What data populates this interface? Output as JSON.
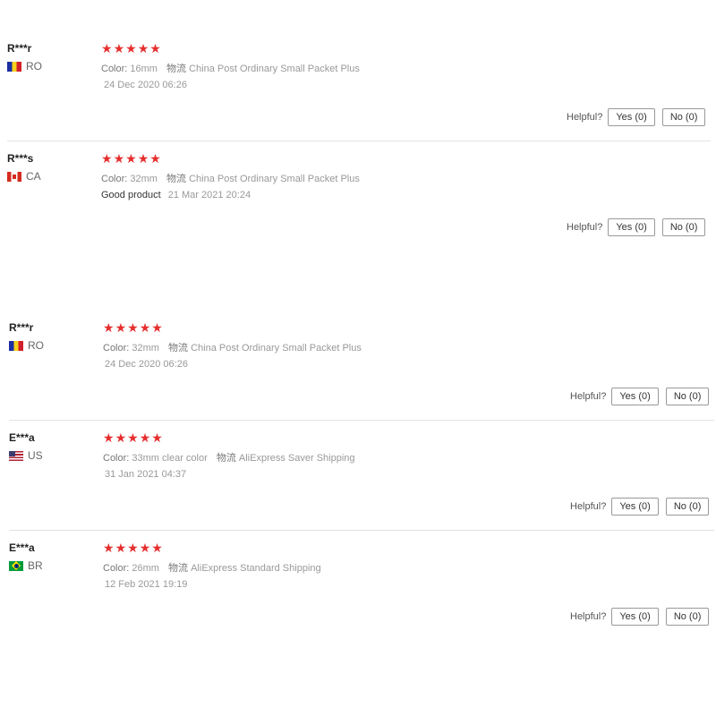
{
  "labels": {
    "color": "Color:",
    "logistics": "物流",
    "helpful": "Helpful?",
    "star_glyph": "★"
  },
  "reviews": [
    {
      "user": "R***r",
      "country": "RO",
      "flag_icon": "romania-flag-icon",
      "rating": 5,
      "color_value": "16mm",
      "shipping": "China Post Ordinary Small Packet Plus",
      "text": "",
      "date": "24 Dec 2020 06:26",
      "yes": "Yes (0)",
      "no": "No (0)"
    },
    {
      "user": "R***s",
      "country": "CA",
      "flag_icon": "canada-flag-icon",
      "rating": 5,
      "color_value": "32mm",
      "shipping": "China Post Ordinary Small Packet Plus",
      "text": "Good product",
      "date": "21 Mar 2021 20:24",
      "yes": "Yes (0)",
      "no": "No (0)"
    },
    {
      "user": "R***r",
      "country": "RO",
      "flag_icon": "romania-flag-icon",
      "rating": 5,
      "color_value": "32mm",
      "shipping": "China Post Ordinary Small Packet Plus",
      "text": "",
      "date": "24 Dec 2020 06:26",
      "yes": "Yes (0)",
      "no": "No (0)"
    },
    {
      "user": "E***a",
      "country": "US",
      "flag_icon": "united-states-flag-icon",
      "rating": 5,
      "color_value": "33mm clear color",
      "shipping": "AliExpress Saver Shipping",
      "text": "",
      "date": "31 Jan 2021 04:37",
      "yes": "Yes (0)",
      "no": "No (0)"
    },
    {
      "user": "E***a",
      "country": "BR",
      "flag_icon": "brazil-flag-icon",
      "rating": 5,
      "color_value": "26mm",
      "shipping": "AliExpress Standard Shipping",
      "text": "",
      "date": "12 Feb 2021 19:19",
      "yes": "Yes (0)",
      "no": "No (0)"
    }
  ]
}
